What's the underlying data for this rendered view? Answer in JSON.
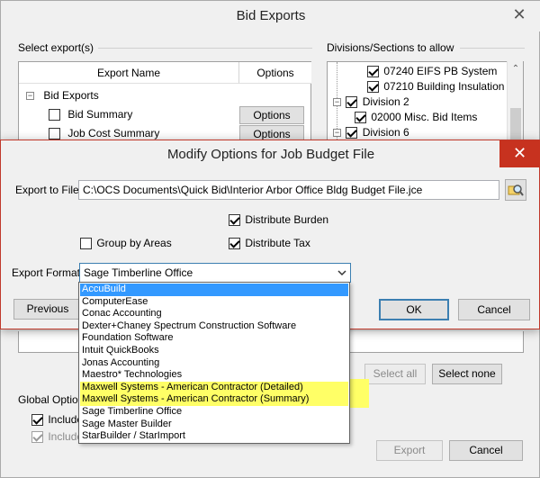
{
  "bid_exports": {
    "title": "Bid Exports",
    "select_exports_label": "Select export(s)",
    "divisions_label": "Divisions/Sections to allow",
    "columns": {
      "name": "Export Name",
      "options": "Options"
    },
    "tree": {
      "root": "Bid Exports",
      "items": [
        {
          "label": "Bid Summary",
          "options": "Options"
        },
        {
          "label": "Job Cost Summary",
          "options": "Options"
        }
      ]
    },
    "divisions": [
      "07240 EIFS PB System",
      "07210 Building Insulation",
      "Division 2",
      "02000 Misc. Bid Items",
      "Division 6"
    ],
    "select_all": "Select all",
    "select_none": "Select none",
    "global_options": "Global Option",
    "include_1": "Include",
    "include_2": "Include",
    "export": "Export",
    "cancel": "Cancel"
  },
  "modify": {
    "title": "Modify Options for Job Budget File",
    "export_to_file_label": "Export to File",
    "export_path": "C:\\OCS Documents\\Quick Bid\\Interior Arbor Office Bldg Budget File.jce",
    "distribute_burden": "Distribute Burden",
    "group_by_areas": "Group by Areas",
    "distribute_tax": "Distribute Tax",
    "export_format_label": "Export Format",
    "export_format_value": "Sage Timberline Office",
    "previous": "Previous",
    "ok": "OK",
    "cancel": "Cancel"
  },
  "format_options": [
    "AccuBuild",
    "ComputerEase",
    "Conac Accounting",
    "Dexter+Chaney Spectrum Construction Software",
    "Foundation Software",
    "Intuit QuickBooks",
    "Jonas Accounting",
    "Maestro* Technologies",
    "Maxwell Systems - American Contractor (Detailed)",
    "Maxwell Systems - American Contractor (Summary)",
    "Sage Timberline Office",
    "Sage Master Builder",
    "StarBuilder / StarImport"
  ],
  "icons": {
    "close": "close-icon",
    "browse": "magnifier-folder-icon",
    "dropdown": "chevron-down-icon",
    "scroll_up": "chevron-up-icon"
  }
}
